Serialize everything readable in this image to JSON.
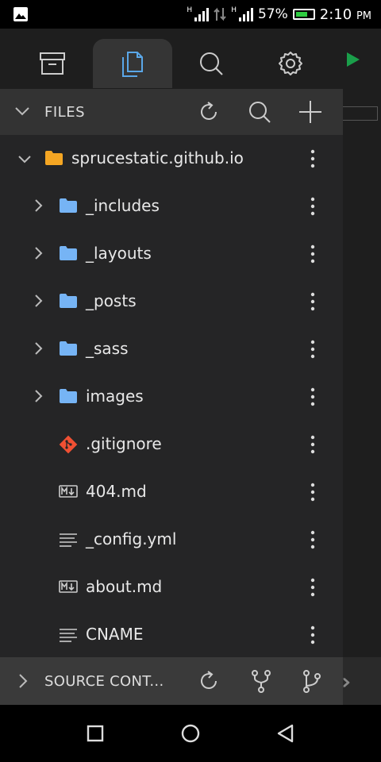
{
  "status_bar": {
    "network_1": "H",
    "network_2": "H",
    "battery": "57%",
    "time": "2:10",
    "ampm": "PM"
  },
  "tabs": [
    {
      "icon": "archive-icon",
      "active": false
    },
    {
      "icon": "files-icon",
      "active": true
    },
    {
      "icon": "search-icon",
      "active": false
    },
    {
      "icon": "gear-icon",
      "active": false
    }
  ],
  "files_panel": {
    "title": "FILES",
    "actions": [
      "refresh-icon",
      "search-icon",
      "plus-icon"
    ]
  },
  "tree": {
    "root": "sprucestatic.github.io",
    "items": [
      {
        "name": "_includes",
        "type": "folder"
      },
      {
        "name": "_layouts",
        "type": "folder"
      },
      {
        "name": "_posts",
        "type": "folder"
      },
      {
        "name": "_sass",
        "type": "folder"
      },
      {
        "name": "images",
        "type": "folder"
      },
      {
        "name": ".gitignore",
        "type": "git"
      },
      {
        "name": "404.md",
        "type": "markdown"
      },
      {
        "name": "_config.yml",
        "type": "text"
      },
      {
        "name": "about.md",
        "type": "markdown"
      },
      {
        "name": "CNAME",
        "type": "text"
      }
    ]
  },
  "source_control": {
    "title": "SOURCE CONT..."
  },
  "colors": {
    "folder_root": "#f5a623",
    "folder": "#76b4f5",
    "git": "#f05033",
    "active_tab_icon": "#5aa7e8",
    "run_green": "#1a9e4a"
  }
}
